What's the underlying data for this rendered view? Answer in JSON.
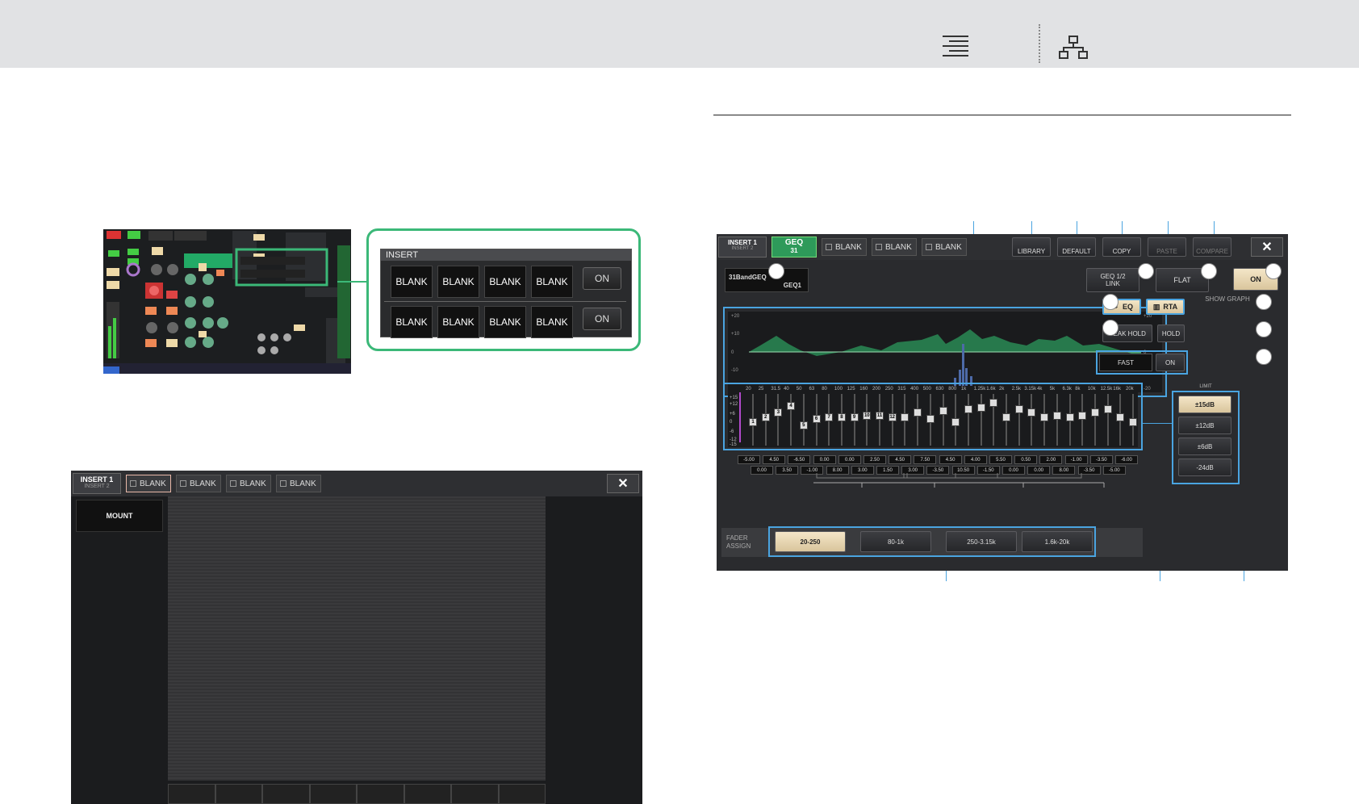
{
  "insert_zoom": {
    "header": "INSERT",
    "row1": [
      "BLANK",
      "BLANK",
      "BLANK",
      "BLANK"
    ],
    "row2": [
      "BLANK",
      "BLANK",
      "BLANK",
      "BLANK"
    ],
    "on_label": "ON"
  },
  "insert_window": {
    "tab_main": "INSERT 1",
    "tab_sub": "INSERT 2",
    "slots": [
      "BLANK",
      "BLANK",
      "BLANK",
      "BLANK"
    ],
    "close_label": "✕",
    "mount_label": "MOUNT"
  },
  "geq_window": {
    "tab_main": "INSERT 1",
    "tab_sub": "INSERT 2",
    "active_slot_line1": "GEQ",
    "active_slot_line2": "31",
    "slots": [
      "BLANK",
      "BLANK",
      "BLANK"
    ],
    "toolbar": [
      "LIBRARY",
      "DEFAULT",
      "COPY",
      "PASTE",
      "COMPARE"
    ],
    "close_label": "✕",
    "rack_name": "31BandGEQ",
    "rack_id": "GEQ1",
    "link_label1": "GEQ 1/2",
    "link_label2": "LINK",
    "flat_label": "FLAT",
    "on_label": "ON",
    "show_graph": "SHOW GRAPH",
    "eq_label": "EQ",
    "rta_label": "RTA",
    "peak_hold": "PEAK HOLD",
    "hold": "HOLD",
    "fast": "FAST",
    "rta_on": "ON",
    "limit_title": "LIMIT",
    "limits": [
      "±15dB",
      "±12dB",
      "±6dB",
      "-24dB"
    ],
    "fader_assign_1": "FADER",
    "fader_assign_2": "ASSIGN",
    "assign_buttons": [
      "20-250",
      "80-1k",
      "250-3.15k",
      "1.6k-20k"
    ],
    "graph_y": [
      "+20",
      "+10",
      "0",
      "-10",
      "-20"
    ],
    "fader_y_left": [
      "+15",
      "+12",
      "+6",
      "0",
      "-6",
      "-12",
      "-15"
    ],
    "freqs": [
      "20",
      "25",
      "31.5",
      "40",
      "50",
      "63",
      "80",
      "100",
      "125",
      "160",
      "200",
      "250",
      "315",
      "400",
      "500",
      "630",
      "800",
      "1k",
      "1.25k",
      "1.6k",
      "2k",
      "2.5k",
      "3.15k",
      "4k",
      "5k",
      "6.3k",
      "8k",
      "10k",
      "12.5k",
      "16k",
      "20k"
    ],
    "values_top": [
      "-5.00",
      "4.50",
      "-6.50",
      "0.00",
      "0.00",
      "2.50",
      "4.50",
      "7.50",
      "4.50",
      "4.00",
      "5.50",
      "0.50",
      "2.00",
      "-1.00",
      "-3.50",
      "-6.00"
    ],
    "values_bottom": [
      "0.00",
      "3.50",
      "-1.00",
      "8.00",
      "3.00",
      "1.50",
      "3.00",
      "-3.50",
      "10.50",
      "-1.50",
      "0.00",
      "0.00",
      "8.00",
      "-3.50",
      "-5.00"
    ],
    "fader_labels": [
      "1",
      "2",
      "3",
      "4",
      "5",
      "6",
      "7",
      "8",
      "9",
      "10",
      "11",
      "12"
    ]
  },
  "colors": {
    "accent": "#3bb878",
    "callout": "#4aa4e0",
    "geq_active": "#2e9a5a"
  }
}
